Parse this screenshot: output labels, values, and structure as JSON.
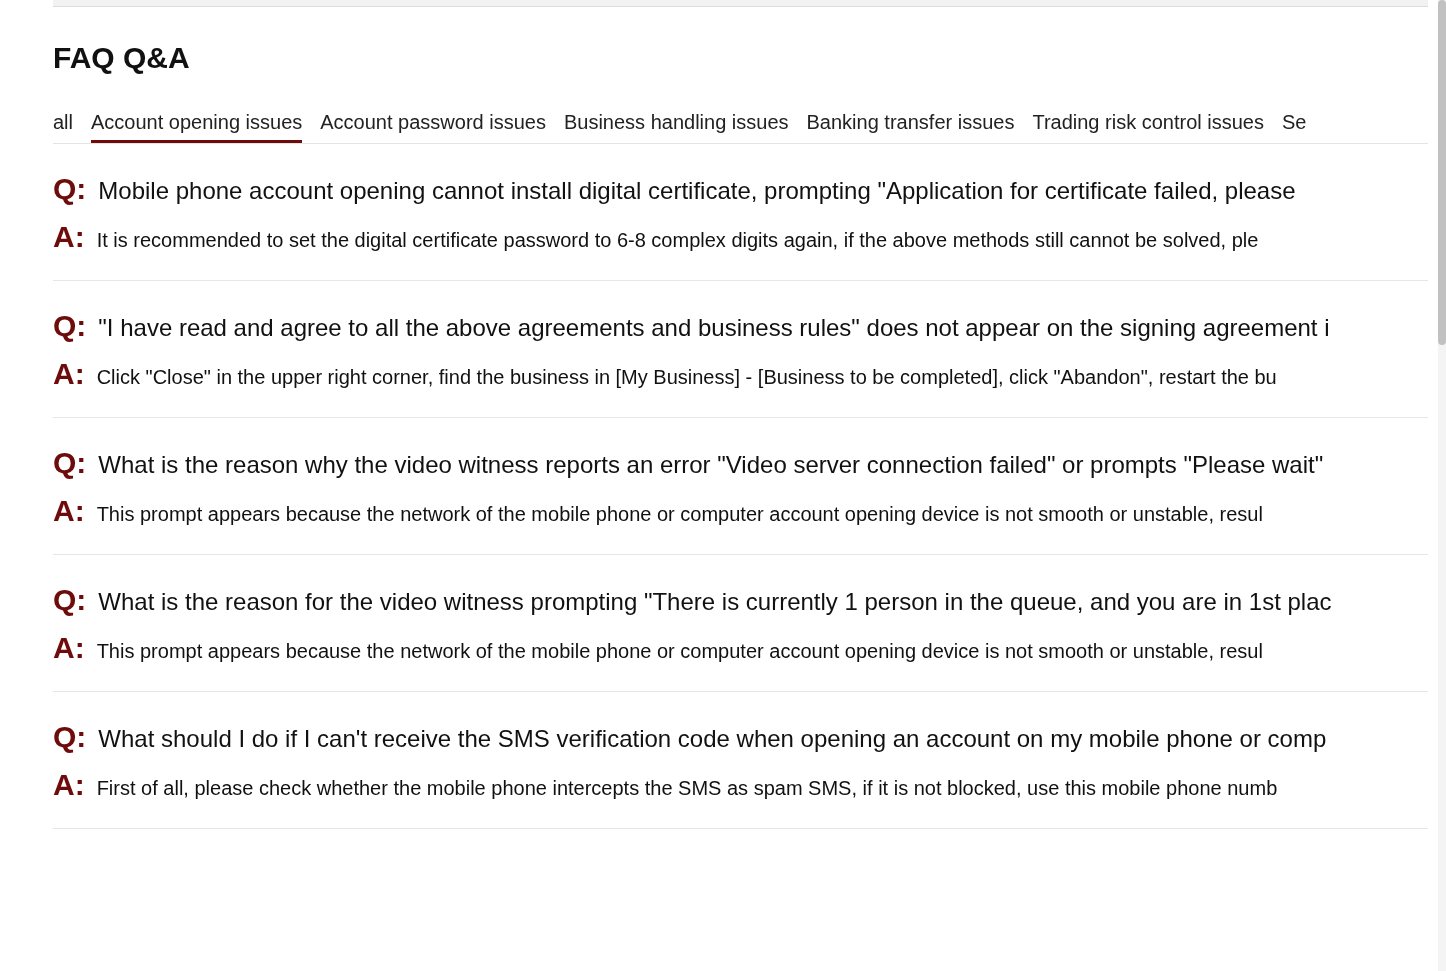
{
  "title": "FAQ Q&A",
  "tabs": [
    {
      "label": "all",
      "selected": false
    },
    {
      "label": "Account opening issues",
      "selected": true
    },
    {
      "label": "Account password issues",
      "selected": false
    },
    {
      "label": "Business handling issues",
      "selected": false
    },
    {
      "label": "Banking transfer issues",
      "selected": false
    },
    {
      "label": "Trading risk control issues",
      "selected": false
    },
    {
      "label": "Se",
      "selected": false
    }
  ],
  "faqs": [
    {
      "q_label": "Q:",
      "question": "Mobile phone account opening cannot install digital certificate, prompting \"Application for certificate failed, please",
      "a_label": "A:",
      "answer": "It is recommended to set the digital certificate password to 6-8 complex digits again, if the above methods still cannot be solved, ple"
    },
    {
      "q_label": "Q:",
      "question": "\"I have read and agree to all the above agreements and business rules\" does not appear on the signing agreement i",
      "a_label": "A:",
      "answer": "Click \"Close\" in the upper right corner, find the business in [My Business] - [Business to be completed], click \"Abandon\", restart the bu"
    },
    {
      "q_label": "Q:",
      "question": "What is the reason why the video witness reports an error \"Video server connection failed\" or prompts \"Please wait\"",
      "a_label": "A:",
      "answer": "This prompt appears because the network of the mobile phone or computer account opening device is not smooth or unstable, resul"
    },
    {
      "q_label": "Q:",
      "question": "What is the reason for the video witness prompting \"There is currently 1 person in the queue, and you are in 1st plac",
      "a_label": "A:",
      "answer": "This prompt appears because the network of the mobile phone or computer account opening device is not smooth or unstable, resul"
    },
    {
      "q_label": "Q:",
      "question": "What should I do if I can't receive the SMS verification code when opening an account on my mobile phone or comp",
      "a_label": "A:",
      "answer": "First of all, please check whether the mobile phone intercepts the SMS as spam SMS, if it is not blocked, use this mobile phone numb"
    }
  ]
}
